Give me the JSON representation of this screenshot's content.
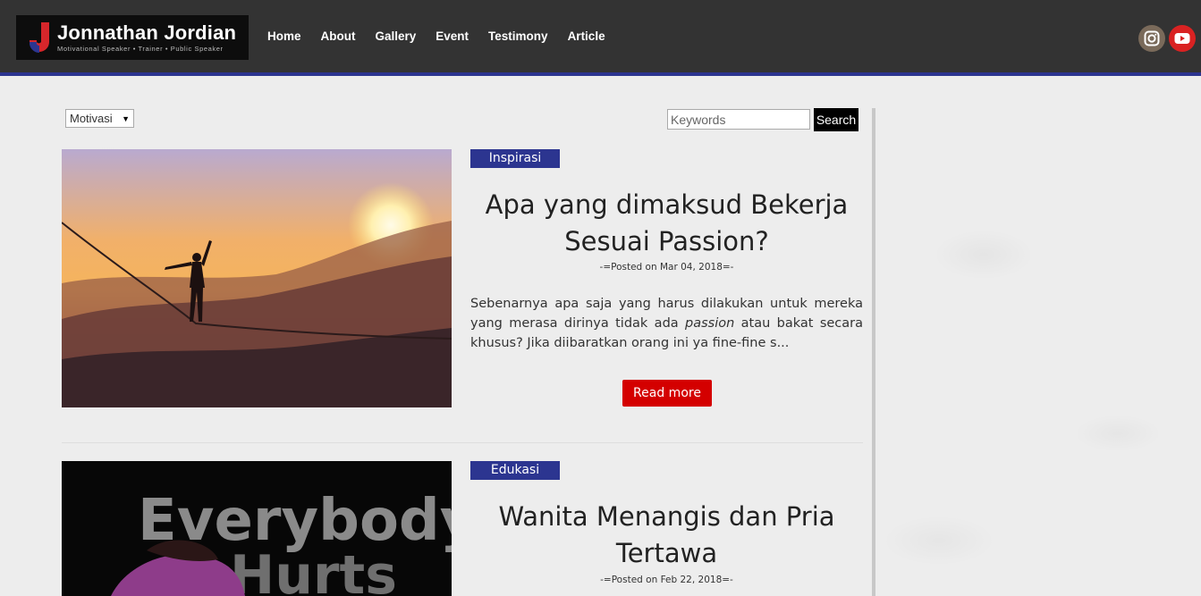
{
  "header": {
    "logo_name": "Jonnathan Jordian",
    "logo_tagline": "Motivational Speaker  •  Trainer  •  Public Speaker",
    "nav": [
      "Home",
      "About",
      "Gallery",
      "Event",
      "Testimony",
      "Article"
    ],
    "social": [
      "instagram-icon",
      "youtube-icon"
    ]
  },
  "filters": {
    "category_selected": "Motivasi",
    "search_placeholder": "Keywords",
    "search_label": "Search"
  },
  "articles": [
    {
      "category": "Inspirasi",
      "title": "Apa yang dimaksud Bekerja Sesuai Passion?",
      "posted": "-=Posted on Mar 04, 2018=-",
      "excerpt_before": "Sebenarnya apa saja yang harus dilakukan untuk mereka yang merasa dirinya tidak ada ",
      "excerpt_em": "passion",
      "excerpt_after": " atau bakat secara khusus? Jika diibaratkan orang ini ya fine-fine s...",
      "read_more": "Read more"
    },
    {
      "category": "Edukasi",
      "title": "Wanita Menangis dan Pria Tertawa",
      "posted": "-=Posted on Feb 22, 2018=-",
      "image_text_line1": "Everybody",
      "image_text_line2": "Hurts"
    }
  ],
  "colors": {
    "header_bg": "#333333",
    "accent_blue": "#2c3590",
    "read_more_red": "#d40000"
  }
}
